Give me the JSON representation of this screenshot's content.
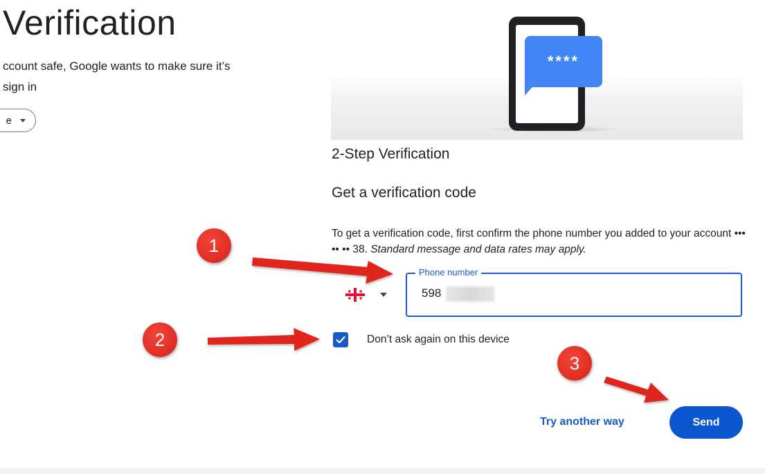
{
  "left_panel": {
    "title": "Verification",
    "desc_line1": "ccount safe, Google wants to make sure it’s",
    "desc_line2": "sign in",
    "language_select_value": "e"
  },
  "illustration": {
    "bubble_text": "****"
  },
  "content": {
    "step_title": "2-Step Verification",
    "code_title": "Get a verification code",
    "info_text": "To get a verification code, first confirm the phone number you added to your account ••• •• •• 38.",
    "info_italic": "Standard message and data rates may apply."
  },
  "phone_field": {
    "label": "Phone number",
    "value": "598",
    "country_icon": "georgia-flag-icon"
  },
  "checkbox": {
    "checked": true,
    "label": "Don’t ask again on this device"
  },
  "actions": {
    "try_another_label": "Try another way",
    "send_label": "Send"
  },
  "annotations": {
    "badge_1": "1",
    "badge_2": "2",
    "badge_3": "3"
  },
  "colors": {
    "primary": "#0b57d0",
    "focus_border": "#1a5ac8",
    "bubble": "#4285f4",
    "annotation": "#e0281e"
  }
}
